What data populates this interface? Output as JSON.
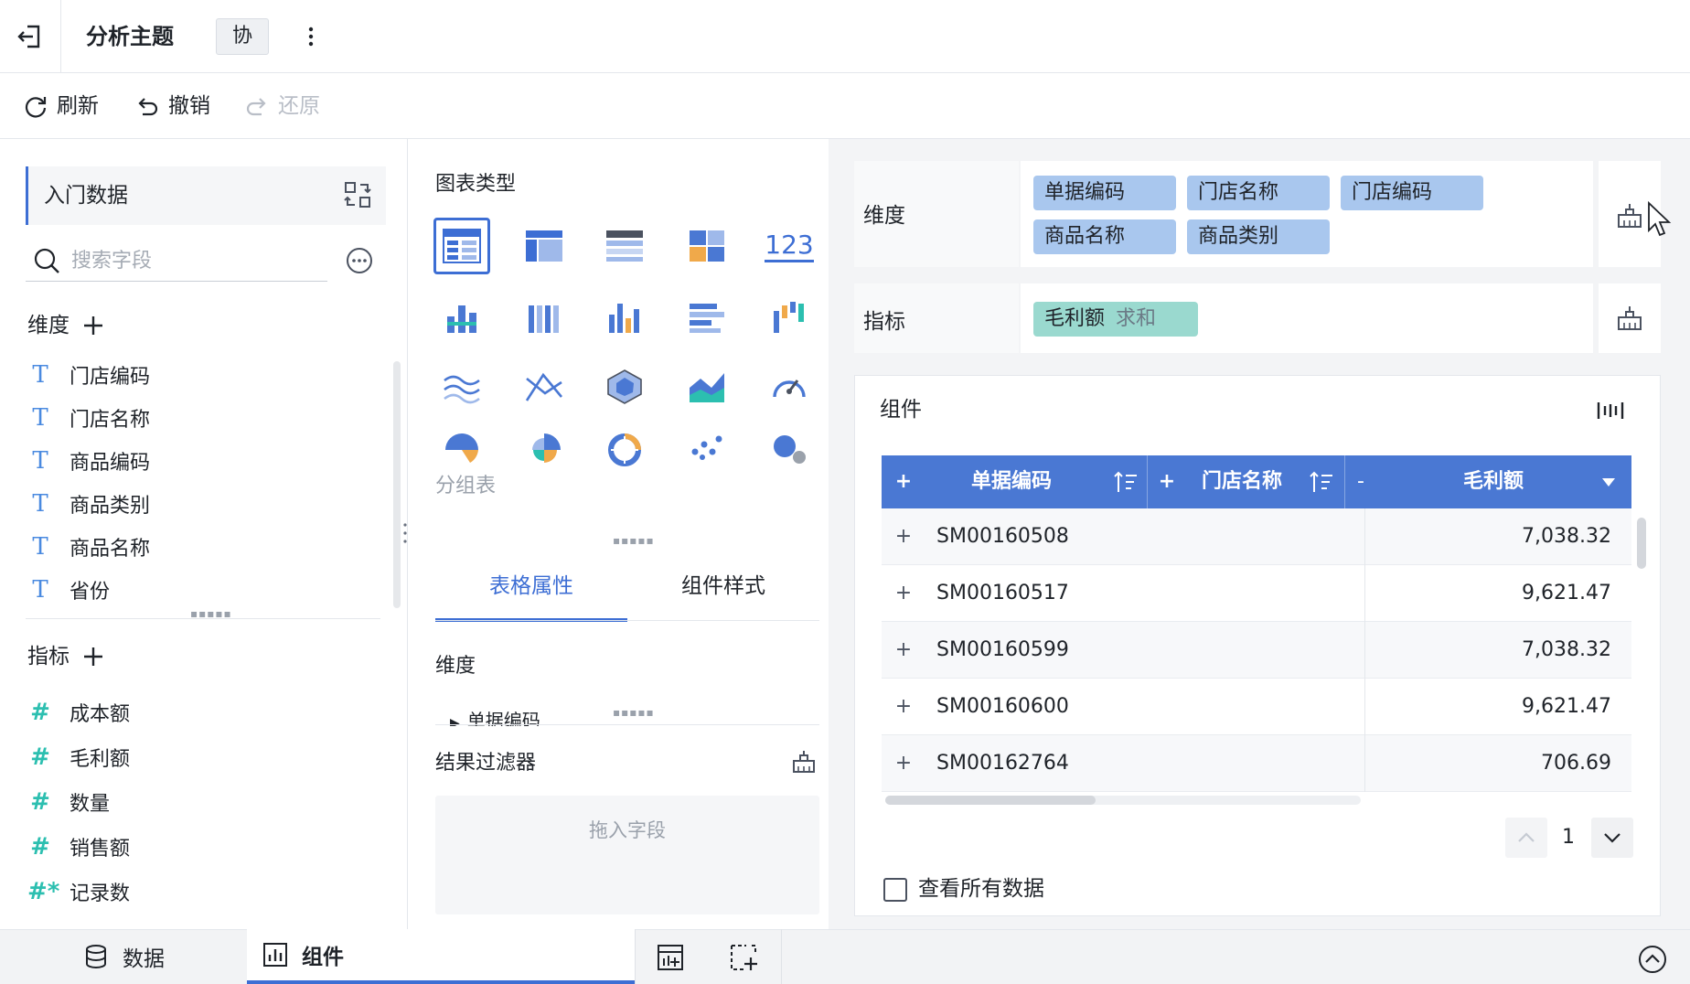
{
  "header": {
    "title": "分析主题",
    "collab_label": "协"
  },
  "toolbar": {
    "refresh_label": "刷新",
    "undo_label": "撤销",
    "redo_label": "还原"
  },
  "left_panel": {
    "dataset_name": "入门数据",
    "search_placeholder": "搜索字段",
    "dimension_title": "维度",
    "dimension_fields": [
      "门店编码",
      "门店名称",
      "商品编码",
      "商品类别",
      "商品名称",
      "省份"
    ],
    "indicator_title": "指标",
    "indicator_fields": [
      "成本额",
      "毛利额",
      "数量",
      "销售额",
      "记录数"
    ],
    "record_icon_glyph": "#*"
  },
  "middle_panel": {
    "chart_type_title": "图表类型",
    "number_chart_glyph": "123",
    "selected_chart_label": "分组表",
    "tabs": [
      "表格属性",
      "组件样式"
    ],
    "dimension_title": "维度",
    "dimension_item": "单据编码",
    "filter_title": "结果过滤器",
    "drop_placeholder": "拖入字段"
  },
  "right_panel": {
    "dimension_label": "维度",
    "dimension_chips": [
      "单据编码",
      "门店名称",
      "门店编码",
      "商品名称",
      "商品类别"
    ],
    "indicator_label": "指标",
    "indicator_chip": {
      "name": "毛利额",
      "aggregation": "求和"
    },
    "component_title": "组件",
    "table": {
      "columns": [
        {
          "expander": "+",
          "label": "单据编码"
        },
        {
          "expander": "+",
          "label": "门店名称"
        },
        {
          "expander": "-",
          "label": "毛利额"
        }
      ],
      "rows": [
        {
          "code": "SM00160508",
          "value": "7,038.32"
        },
        {
          "code": "SM00160517",
          "value": "9,621.47"
        },
        {
          "code": "SM00160599",
          "value": "7,038.32"
        },
        {
          "code": "SM00160600",
          "value": "9,621.47"
        },
        {
          "code": "SM00162764",
          "value": "706.69"
        }
      ],
      "row_expander": "+"
    },
    "page_number": "1",
    "view_all_label": "查看所有数据"
  },
  "bottom_bar": {
    "data_tab": "数据",
    "component_tab": "组件"
  },
  "colors": {
    "accent": "#3d6ed4",
    "table_header": "#4a78d3",
    "dimension_chip": "#a9c7ee",
    "indicator_chip": "#9ad9cf",
    "dimension_icon": "#4a8ae0",
    "indicator_icon": "#2cbfb0"
  }
}
